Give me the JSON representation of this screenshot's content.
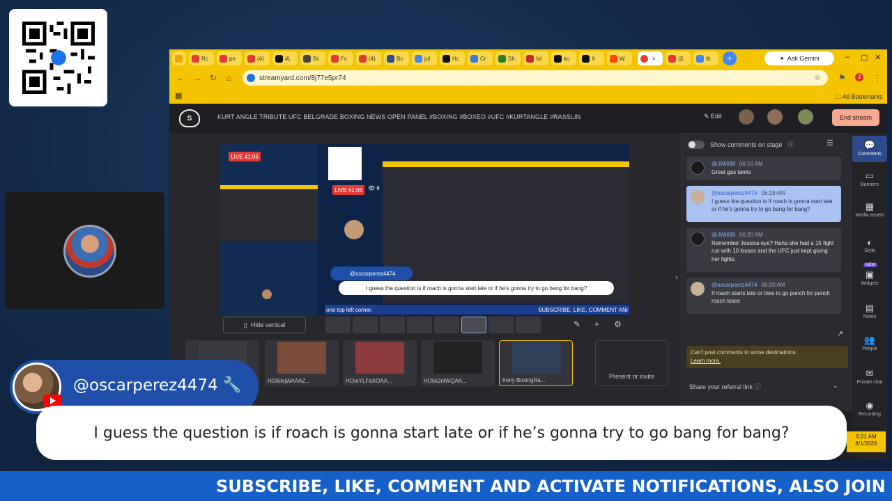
{
  "qr": {
    "label": "qr-code"
  },
  "browser": {
    "tabs": [
      "Rc",
      "pe",
      "(4)",
      "#L",
      "Bc",
      "Fc",
      "(4)",
      "Bc",
      "jul",
      "Hc",
      "Cr",
      "Sh",
      "Isl",
      "ku",
      "X",
      "W",
      "",
      "(3",
      "th"
    ],
    "gemini_label": "Ask Gemini",
    "url": "streamyard.com/8j77e5pr74",
    "bookmarks_label": "All Bookmarks"
  },
  "streamyard": {
    "title": "KURT ANGLE TRIBUTE UFC BELGRADE BOXING NEWS OPEN PANEL #BOXING #BOXEO #UFC #KURTANGLE #RASSLIN",
    "edit_label": "Edit",
    "end_stream_label": "End stream",
    "stage": {
      "live_label": "LIVE 41:06",
      "viewers": "6",
      "comment_handle": "@oscarperez4474",
      "comment_text": "I guess the question is if roach is gonna start late or if he's gonna try to go bang for bang?",
      "ticker_left": "one top left corner.",
      "ticker_right": "SUBSCRIBE, LIKE, COMMENT ANI"
    },
    "hide_vertical_label": "Hide vertical",
    "sources": [
      {
        "label": ""
      },
      {
        "label": "HOi6lejWAAAZ..."
      },
      {
        "label": "HOmYLFaXOAA..."
      },
      {
        "label": "HOkk2nlWQAA..."
      },
      {
        "label": "Irony BoxingRa..."
      }
    ],
    "present_label": "Present or invite",
    "comments_panel": {
      "show_on_stage_label": "Show comments on stage",
      "comments": [
        {
          "user": "@JWill38",
          "time": "06:16 AM",
          "text": "Great gas tanks"
        },
        {
          "user": "@oscarperez4474",
          "time": "06:19 AM",
          "text": "I guess the question is if roach is gonna start late or if he's gonna try to go bang for bang?"
        },
        {
          "user": "@JWill38",
          "time": "06:20 AM",
          "text": "Remember Jessica eye? Haha she had a 15 fight run with 10 losses and the UFC just kept giving her fights"
        },
        {
          "user": "@oscarperez4474",
          "time": "06:20 AM",
          "text": "If roach starts late or tries to go punch for punch roach loses"
        }
      ],
      "cant_post": "Can't post comments to some destinations.",
      "learn_more": "Learn more.",
      "referral_label": "Share your referral link"
    },
    "rail": [
      {
        "icon": "💬",
        "label": "Comments"
      },
      {
        "icon": "▭",
        "label": "Banners"
      },
      {
        "icon": "▦",
        "label": "Media assets"
      },
      {
        "icon": "◐",
        "label": "Style"
      },
      {
        "icon": "▣",
        "label": "Widgets"
      },
      {
        "icon": "▤",
        "label": "Notes"
      },
      {
        "icon": "👥",
        "label": "People"
      },
      {
        "icon": "✉",
        "label": "Private chat"
      },
      {
        "icon": "◉",
        "label": "Recording"
      }
    ],
    "new_badge": "NEW"
  },
  "clock": {
    "time": "6:21 AM",
    "date": "8/1/2026"
  },
  "overlay": {
    "handle": "@oscarperez4474",
    "text": "I guess the question is if roach is gonna start late or if he’s gonna try to go bang for bang?"
  },
  "ticker": {
    "text": "SUBSCRIBE, LIKE, COMMENT AND ACTIVATE NOTIFICATIONS, ALSO JOIN MY D"
  },
  "colors": {
    "accent_yellow": "#f5c400",
    "streamyard_blue": "#1f4fa8",
    "ticker_blue": "#1560c9",
    "end_stream": "#f6a98e"
  }
}
